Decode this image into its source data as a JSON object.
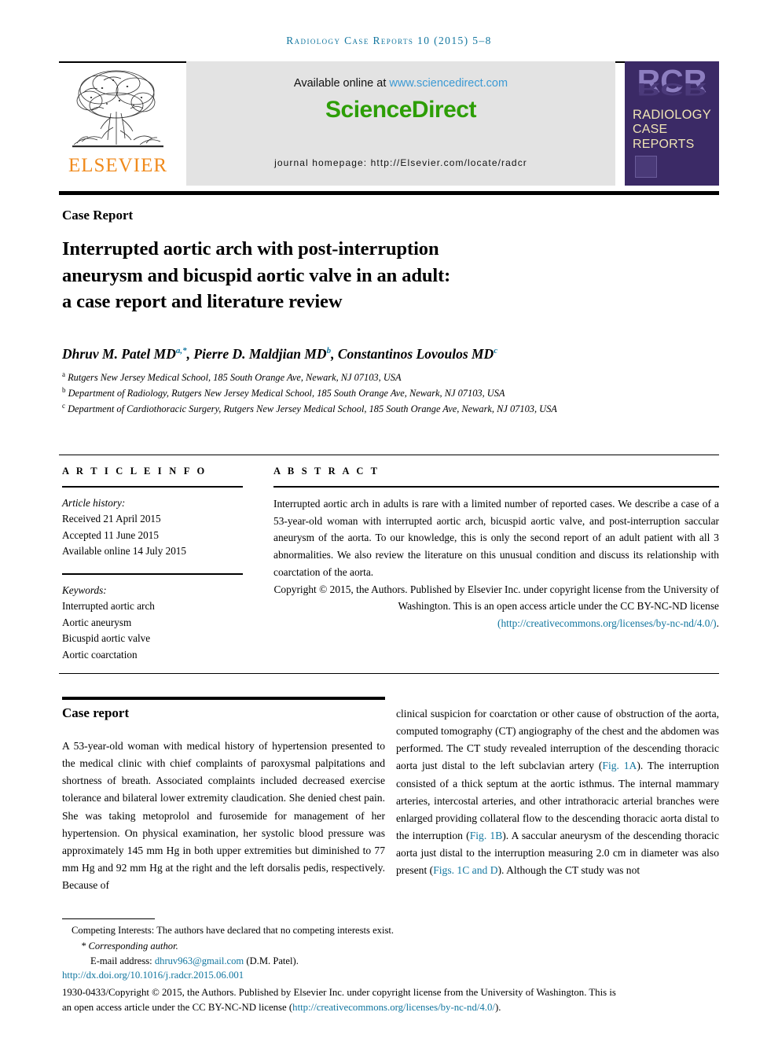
{
  "running_head": "Radiology Case Reports 10 (2015) 5–8",
  "masthead": {
    "publisher_word": "ELSEVIER",
    "available_prefix": "Available online at ",
    "available_url": "www.sciencedirect.com",
    "sciencedirect_logo": "ScienceDirect",
    "journal_homepage": "journal homepage: http://Elsevier.com/locate/radcr",
    "cover": {
      "acronym": "RCR",
      "line1": "RADIOLOGY",
      "line2": "CASE",
      "line3": "REPORTS"
    }
  },
  "article": {
    "kicker": "Case Report",
    "title_line1": "Interrupted aortic arch with post-interruption",
    "title_line2": "aneurysm and bicuspid aortic valve in an adult:",
    "title_line3": "a case report and literature review",
    "authors": [
      {
        "name": "Dhruv M. Patel MD",
        "sup": "a,",
        "star": "*",
        "sep": ", "
      },
      {
        "name": "Pierre D. Maldjian MD",
        "sup": "b",
        "star": "",
        "sep": ", "
      },
      {
        "name": "Constantinos Lovoulos MD",
        "sup": "c",
        "star": "",
        "sep": ""
      }
    ],
    "affiliations": [
      {
        "marker": "a",
        "text": "Rutgers New Jersey Medical School, 185 South Orange Ave, Newark, NJ 07103, USA"
      },
      {
        "marker": "b",
        "text": "Department of Radiology, Rutgers New Jersey Medical School, 185 South Orange Ave, Newark, NJ 07103, USA"
      },
      {
        "marker": "c",
        "text": "Department of Cardiothoracic Surgery, Rutgers New Jersey Medical School, 185 South Orange Ave, Newark, NJ 07103, USA"
      }
    ]
  },
  "article_info": {
    "label": "A R T I C L E   I N F O",
    "history_label": "Article history:",
    "received": "Received 21 April 2015",
    "accepted": "Accepted 11 June 2015",
    "available_online": "Available online 14 July 2015",
    "keywords_label": "Keywords:",
    "keywords": [
      "Interrupted aortic arch",
      "Aortic aneurysm",
      "Bicuspid aortic valve",
      "Aortic coarctation"
    ]
  },
  "abstract": {
    "label": "A B S T R A C T",
    "text": "Interrupted aortic arch in adults is rare with a limited number of reported cases. We describe a case of a 53-year-old woman with interrupted aortic arch, bicuspid aortic valve, and post-interruption saccular aneurysm of the aorta. To our knowledge, this is only the second report of an adult patient with all 3 abnormalities. We also review the literature on this unusual condition and discuss its relationship with coarctation of the aorta.",
    "copyright_part1": "Copyright © 2015, the Authors. Published by Elsevier Inc. under copyright license from the University of Washington. This is an open access article under the CC BY-NC-ND license ",
    "copyright_link": "(http://creativecommons.org/licenses/by-nc-nd/4.0/)",
    "copyright_end": "."
  },
  "body": {
    "heading": "Case report",
    "left_column": "A 53-year-old woman with medical history of hypertension presented to the medical clinic with chief complaints of paroxysmal palpitations and shortness of breath. Associated complaints included decreased exercise tolerance and bilateral lower extremity claudication. She denied chest pain. She was taking metoprolol and furosemide for management of her hypertension. On physical examination, her systolic blood pressure was approximately 145 mm Hg in both upper extremities but diminished to 77 mm Hg and 92 mm Hg at the right and the left dorsalis pedis, respectively. Because of",
    "right_column_1": "clinical suspicion for coarctation or other cause of obstruction of the aorta, computed tomography (CT) angiography of the chest and the abdomen was performed. The CT study revealed interruption of the descending thoracic aorta just distal to the left subclavian artery (",
    "right_fig_1a": "Fig. 1A",
    "right_column_2": "). The interruption consisted of a thick septum at the aortic isthmus. The internal mammary arteries, intercostal arteries, and other intrathoracic arterial branches were enlarged providing collateral flow to the descending thoracic aorta distal to the interruption (",
    "right_fig_1b": "Fig. 1B",
    "right_column_3": "). A saccular aneurysm of the descending thoracic aorta just distal to the interruption measuring 2.0 cm in diameter was also present (",
    "right_fig_1cd": "Figs. 1C and D",
    "right_column_4": "). Although the CT study was not"
  },
  "footnotes": {
    "competing": "Competing Interests: The authors have declared that no competing interests exist.",
    "corresponding_star": "*",
    "corresponding": "Corresponding author.",
    "email_label": "E-mail address: ",
    "email": "dhruv963@gmail.com",
    "email_suffix": " (D.M. Patel).",
    "doi": "http://dx.doi.org/10.1016/j.radcr.2015.06.001",
    "copyright_line_1": "1930-0433/Copyright © 2015, the Authors. Published by Elsevier Inc. under copyright license from the University of Washington. This is",
    "copyright_line_2_pre": "an open access article under the CC BY-NC-ND license (",
    "copyright_line_2_link": "http://creativecommons.org/licenses/by-nc-nd/4.0/",
    "copyright_line_2_post": ")."
  },
  "colors": {
    "accent_teal": "#12769f",
    "elsevier_orange": "#f08a1c",
    "sciencedirect_green": "#2d9e06",
    "cover_purple": "#3b2a66",
    "cover_cream": "#efe4b4",
    "cover_light_purple": "#8d7ec0",
    "banner_gray": "#e3e3e3"
  }
}
